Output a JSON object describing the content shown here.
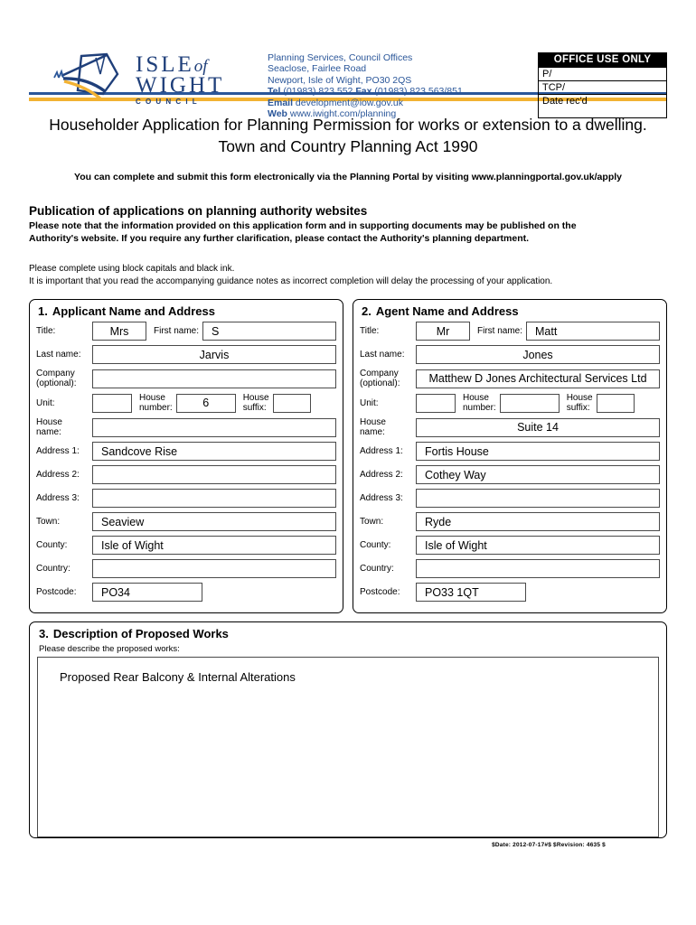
{
  "header": {
    "logo": {
      "isle": "ISLE",
      "of": "of",
      "wight": "WIGHT",
      "council": "COUNCIL"
    },
    "contact": {
      "line1": "Planning Services, Council Offices",
      "line2": "Seaclose, Fairlee Road",
      "line3": "Newport, Isle of Wight, PO30 2QS",
      "tel_label": "Tel",
      "tel_value": " (01983) 823 552 ",
      "fax_label": "Fax",
      "fax_value": " (01983) 823 563/851",
      "email_label": "Email",
      "email_value": " development@iow.gov.uk",
      "web_label": "Web",
      "web_value": " www.iwight.com/planning"
    },
    "office_use": {
      "title": "OFFICE USE ONLY",
      "row1": "P/",
      "row2": "TCP/",
      "row3": "Date rec'd"
    }
  },
  "intro": {
    "title_line1": "Householder Application for Planning Permission for works or extension to a dwelling.",
    "title_line2": "Town and Country Planning Act 1990",
    "portal_line": "You can complete and submit this form electronically via the Planning Portal by visiting www.planningportal.gov.uk/apply",
    "publication_heading": "Publication of applications on planning authority websites",
    "publication_body_line1": "Please note that the information provided on this application form and in supporting documents may be published on the",
    "publication_body_line2": "Authority's website. If you require any further clarification, please contact the Authority's planning department.",
    "note_line1": "Please complete using block capitals and black ink.",
    "note_line2": "It is important that you read the accompanying guidance notes as incorrect completion will delay the processing of your application."
  },
  "section1": {
    "number": "1.",
    "title": "Applicant Name and Address",
    "labels": {
      "title": "Title:",
      "first_name": "First name:",
      "last_name": "Last name:",
      "company": "Company",
      "company_sub": "(optional):",
      "unit": "Unit:",
      "house_number": "House",
      "house_number_sub": "number:",
      "house_suffix": "House",
      "house_suffix_sub": "suffix:",
      "house_name": "House",
      "house_name_sub": "name:",
      "address1": "Address 1:",
      "address2": "Address 2:",
      "address3": "Address 3:",
      "town": "Town:",
      "county": "County:",
      "country": "Country:",
      "postcode": "Postcode:"
    },
    "values": {
      "title": "Mrs",
      "first_name": "S",
      "last_name": "Jarvis",
      "company": "",
      "unit": "",
      "house_number": "6",
      "house_suffix": "",
      "house_name": "",
      "address1": "Sandcove Rise",
      "address2": "",
      "address3": "",
      "town": "Seaview",
      "county": "Isle of Wight",
      "country": "",
      "postcode": "PO34"
    }
  },
  "section2": {
    "number": "2.",
    "title": "Agent Name and Address",
    "labels": {
      "title": "Title:",
      "first_name": "First name:",
      "last_name": "Last name:",
      "company": "Company",
      "company_sub": "(optional):",
      "unit": "Unit:",
      "house_number": "House",
      "house_number_sub": "number:",
      "house_suffix": "House",
      "house_suffix_sub": "suffix:",
      "house_name": "House",
      "house_name_sub": "name:",
      "address1": "Address 1:",
      "address2": "Address 2:",
      "address3": "Address 3:",
      "town": "Town:",
      "county": "County:",
      "country": "Country:",
      "postcode": "Postcode:"
    },
    "values": {
      "title": "Mr",
      "first_name": "Matt",
      "last_name": "Jones",
      "company": "Matthew D Jones Architectural Services Ltd",
      "unit": "",
      "house_number": "",
      "house_suffix": "",
      "house_name": "Suite 14",
      "address1": "Fortis House",
      "address2": "Cothey Way",
      "address3": "",
      "town": "Ryde",
      "county": "Isle of Wight",
      "country": "",
      "postcode": "PO33 1QT"
    }
  },
  "section3": {
    "number": "3.",
    "title": "Description of Proposed Works",
    "describe_label": "Please describe the proposed works:",
    "works_value": "Proposed Rear Balcony & Internal Alterations"
  },
  "footer": {
    "revision": "$Date: 2012-07-17#$ $Revision: 4635 $"
  },
  "colors": {
    "brand_blue": "#2a5699",
    "brand_gold": "#f2b233",
    "logo_navy": "#1f3f7a"
  }
}
